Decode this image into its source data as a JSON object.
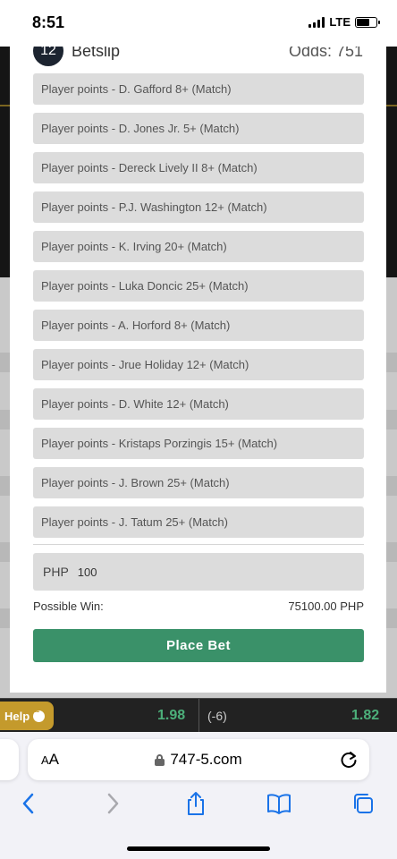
{
  "status_bar": {
    "time": "8:51",
    "network": "LTE",
    "battery_level": 0.65
  },
  "background": {
    "odds_left": "1.98",
    "handicap": "(-6)",
    "odds_right": "1.82",
    "help_label": "Help"
  },
  "betslip": {
    "count": "12",
    "title": "Betslip",
    "odds_label": "Odds: 751",
    "selections": [
      "Player points - D. Gafford 8+ (Match)",
      "Player points - D. Jones Jr. 5+ (Match)",
      "Player points - Dereck Lively II 8+ (Match)",
      "Player points - P.J. Washington 12+ (Match)",
      "Player points - K. Irving 20+ (Match)",
      "Player points - Luka Doncic 25+ (Match)",
      "Player points - A. Horford 8+ (Match)",
      "Player points - Jrue Holiday 12+ (Match)",
      "Player points - D. White 12+ (Match)",
      "Player points - Kristaps Porzingis 15+ (Match)",
      "Player points - J. Brown 25+ (Match)",
      "Player points - J. Tatum 25+ (Match)"
    ],
    "currency": "PHP",
    "stake_value": "100",
    "possible_win_label": "Possible Win:",
    "possible_win_value": "75100.00 PHP",
    "place_bet_label": "Place Bet"
  },
  "browser": {
    "aa_label_big": "A",
    "aa_label_small": "A",
    "url": "747-5.com",
    "accent_color": "#1a73e8"
  },
  "colors": {
    "place_bet": "#3a9169",
    "odds_green": "#4caf7a",
    "help_gold": "#c49a2c"
  }
}
